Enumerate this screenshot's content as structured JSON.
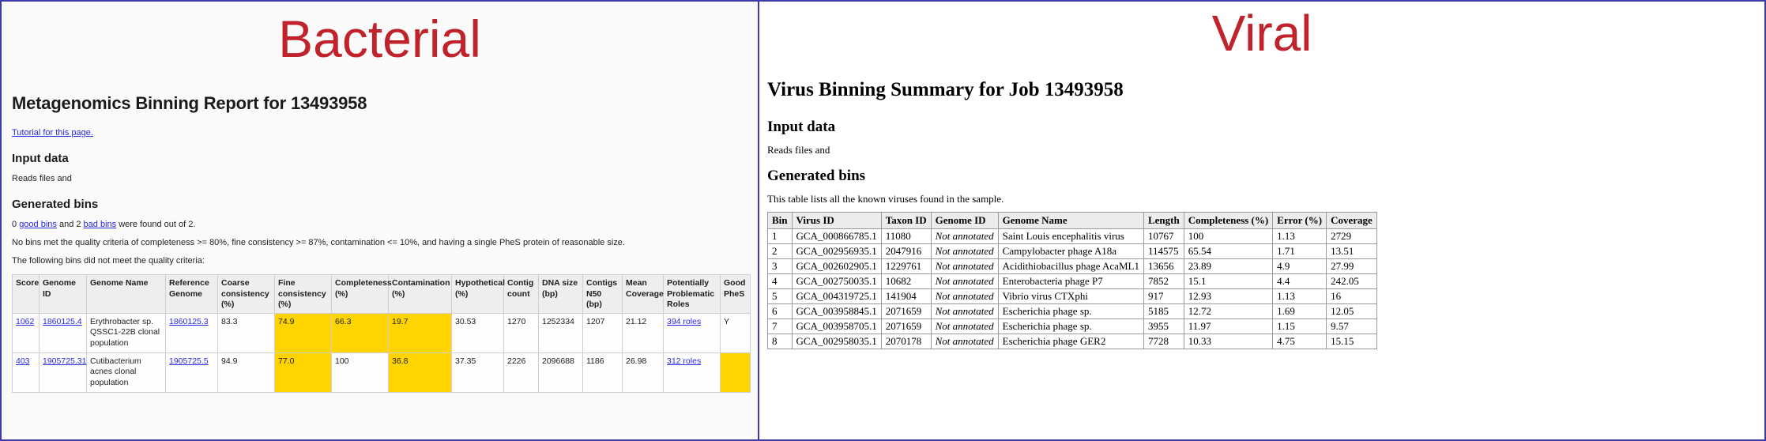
{
  "bacterial": {
    "banner": "Bacterial",
    "title": "Metagenomics Binning Report for 13493958",
    "tutorial_link": "Tutorial for this page.",
    "input_heading": "Input data",
    "input_text": "Reads files and",
    "bins_heading": "Generated bins",
    "counts_prefix": "0 ",
    "good_bins_link": "good bins",
    "counts_mid": " and 2 ",
    "bad_bins_link": "bad bins",
    "counts_suffix": " were found out of 2.",
    "criteria_text": "No bins met the quality criteria of completeness >= 80%, fine consistency >= 87%, contamination <= 10%, and having a single PheS protein of reasonable size.",
    "following_text": "The following bins did not meet the quality criteria:",
    "table": {
      "headers": [
        "Score",
        "Genome ID",
        "Genome Name",
        "Reference Genome",
        "Coarse consistency (%)",
        "Fine consistency (%)",
        "Completeness (%)",
        "Contamination (%)",
        "Hypothetical (%)",
        "Contig count",
        "DNA size (bp)",
        "Contigs N50 (bp)",
        "Mean Coverage",
        "Potentially Problematic Roles",
        "Good PheS"
      ],
      "rows": [
        {
          "score": "1062",
          "genome_id": "1860125.4",
          "genome_name": "Erythrobacter sp. QSSC1-22B clonal population",
          "reference_genome": "1860125.3",
          "coarse_consistency": "83.3",
          "fine_consistency": "74.9",
          "completeness": "66.3",
          "contamination": "19.7",
          "hypothetical": "30.53",
          "contig_count": "1270",
          "dna_size": "1252334",
          "contigs_n50": "1207",
          "mean_coverage": "21.12",
          "problematic_roles": "394 roles",
          "good_phes": "Y"
        },
        {
          "score": "403",
          "genome_id": "1905725.31",
          "genome_name": "Cutibacterium acnes clonal population",
          "reference_genome": "1905725.5",
          "coarse_consistency": "94.9",
          "fine_consistency": "77.0",
          "completeness": "100",
          "contamination": "36.8",
          "hypothetical": "37.35",
          "contig_count": "2226",
          "dna_size": "2096688",
          "contigs_n50": "1186",
          "mean_coverage": "26.98",
          "problematic_roles": "312 roles",
          "good_phes": ""
        }
      ]
    }
  },
  "viral": {
    "banner": "Viral",
    "title": "Virus Binning Summary for Job 13493958",
    "input_heading": "Input data",
    "input_text": "Reads files and",
    "bins_heading": "Generated bins",
    "table_caption": "This table lists all the known viruses found in the sample.",
    "table": {
      "headers": [
        "Bin",
        "Virus ID",
        "Taxon ID",
        "Genome ID",
        "Genome Name",
        "Length",
        "Completeness (%)",
        "Error (%)",
        "Coverage"
      ],
      "not_annotated": "Not annotated",
      "rows": [
        {
          "bin": "1",
          "virus_id": "GCA_000866785.1",
          "taxon_id": "11080",
          "genome_id": "Not annotated",
          "genome_name": "Saint Louis encephalitis virus",
          "length": "10767",
          "completeness": "100",
          "error": "1.13",
          "coverage": "2729"
        },
        {
          "bin": "2",
          "virus_id": "GCA_002956935.1",
          "taxon_id": "2047916",
          "genome_id": "Not annotated",
          "genome_name": "Campylobacter phage A18a",
          "length": "114575",
          "completeness": "65.54",
          "error": "1.71",
          "coverage": "13.51"
        },
        {
          "bin": "3",
          "virus_id": "GCA_002602905.1",
          "taxon_id": "1229761",
          "genome_id": "Not annotated",
          "genome_name": "Acidithiobacillus phage AcaML1",
          "length": "13656",
          "completeness": "23.89",
          "error": "4.9",
          "coverage": "27.99"
        },
        {
          "bin": "4",
          "virus_id": "GCA_002750035.1",
          "taxon_id": "10682",
          "genome_id": "Not annotated",
          "genome_name": "Enterobacteria phage P7",
          "length": "7852",
          "completeness": "15.1",
          "error": "4.4",
          "coverage": "242.05"
        },
        {
          "bin": "5",
          "virus_id": "GCA_004319725.1",
          "taxon_id": "141904",
          "genome_id": "Not annotated",
          "genome_name": "Vibrio virus CTXphi",
          "length": "917",
          "completeness": "12.93",
          "error": "1.13",
          "coverage": "16"
        },
        {
          "bin": "6",
          "virus_id": "GCA_003958845.1",
          "taxon_id": "2071659",
          "genome_id": "Not annotated",
          "genome_name": "Escherichia phage sp.",
          "length": "5185",
          "completeness": "12.72",
          "error": "1.69",
          "coverage": "12.05"
        },
        {
          "bin": "7",
          "virus_id": "GCA_003958705.1",
          "taxon_id": "2071659",
          "genome_id": "Not annotated",
          "genome_name": "Escherichia phage sp.",
          "length": "3955",
          "completeness": "11.97",
          "error": "1.15",
          "coverage": "9.57"
        },
        {
          "bin": "8",
          "virus_id": "GCA_002958035.1",
          "taxon_id": "2070178",
          "genome_id": "Not annotated",
          "genome_name": "Escherichia phage GER2",
          "length": "7728",
          "completeness": "10.33",
          "error": "4.75",
          "coverage": "15.15"
        }
      ]
    }
  },
  "colors": {
    "banner_red": "#c0232c",
    "highlight_yellow": "#ffd400",
    "link_blue": "#2a2ae0",
    "panel_border": "#3b3bab"
  }
}
